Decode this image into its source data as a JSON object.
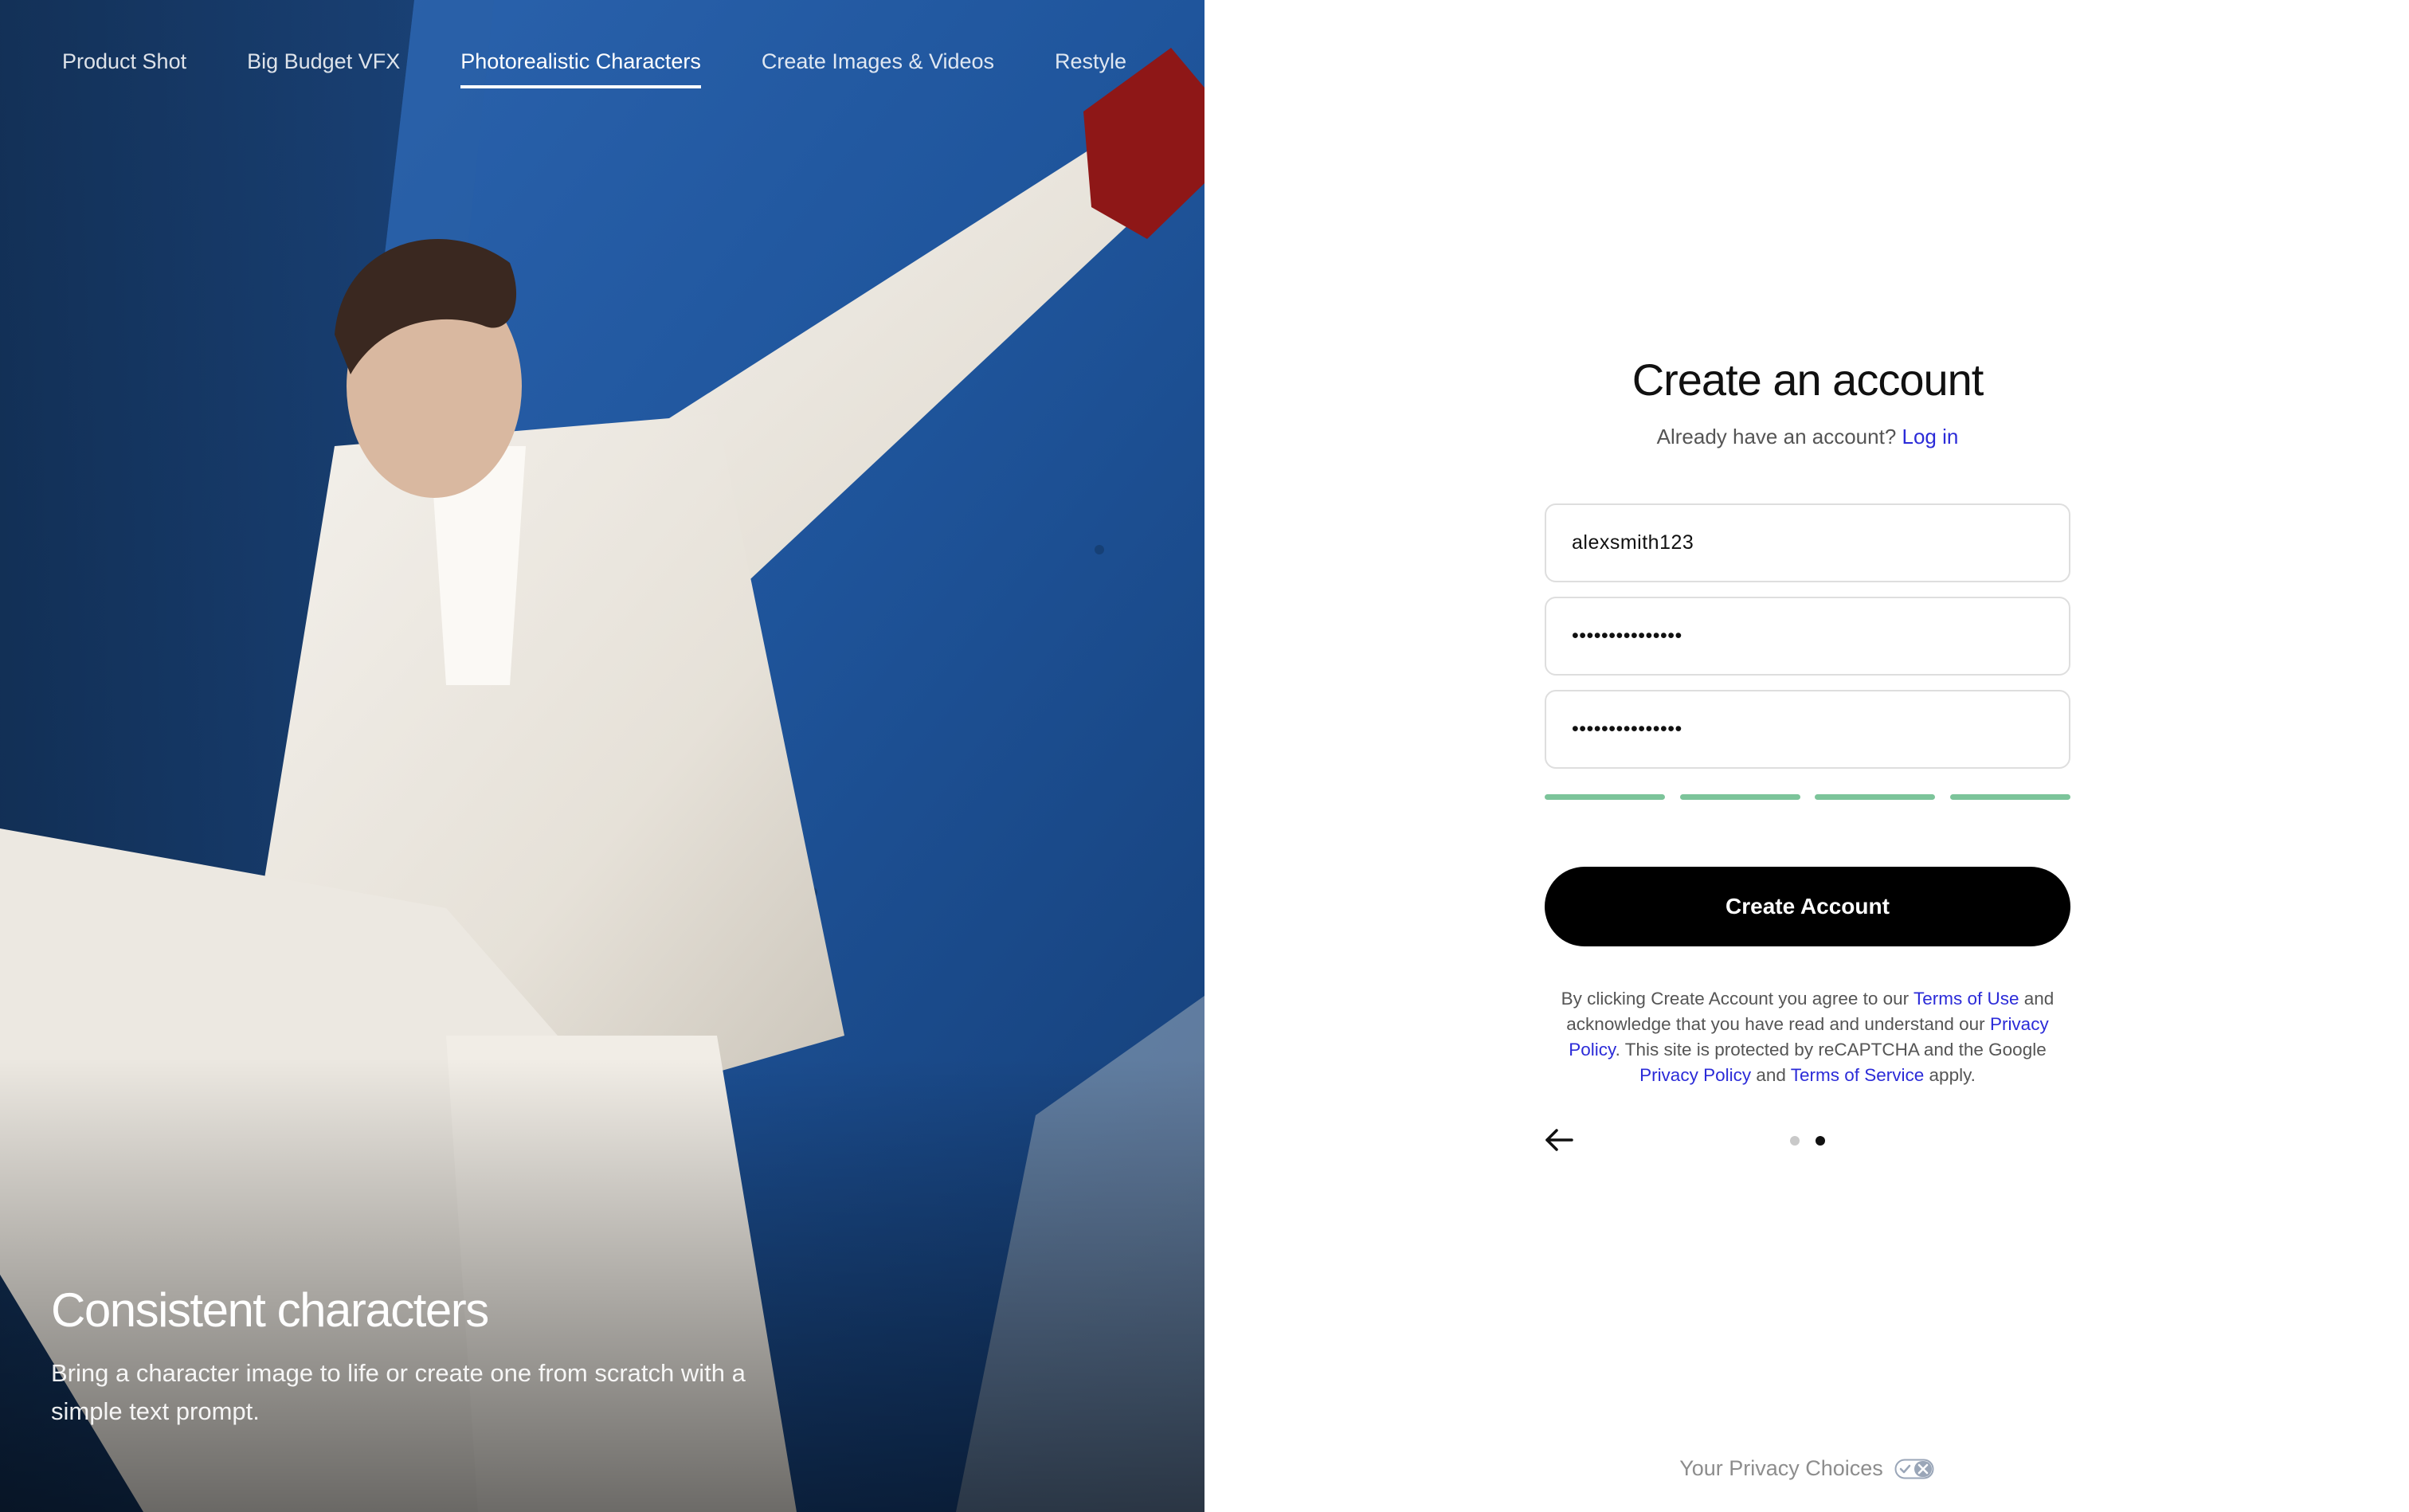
{
  "hero": {
    "tabs": [
      {
        "label": "Product Shot",
        "active": false
      },
      {
        "label": "Big Budget VFX",
        "active": false
      },
      {
        "label": "Photorealistic Characters",
        "active": true
      },
      {
        "label": "Create Images & Videos",
        "active": false
      },
      {
        "label": "Restyle",
        "active": false
      }
    ],
    "title": "Consistent characters",
    "description": "Bring a character image to life or create one from scratch with a simple text prompt."
  },
  "form": {
    "title": "Create an account",
    "login_prompt": "Already have an account?",
    "login_link": "Log in",
    "username_value": "alexsmith123",
    "password_value": "•••••••••••••••",
    "confirm_password_value": "•••••••••••••••",
    "strength_segments": 4,
    "strength_color": "#7cc49a",
    "submit_label": "Create Account",
    "legal": {
      "prefix": "By clicking Create Account you agree to our ",
      "terms_of_use": "Terms of Use",
      "middle1": " and acknowledge that you have read and understand our ",
      "privacy_policy": "Privacy Policy",
      "middle2": ". This site is protected by reCAPTCHA and the Google ",
      "google_privacy": "Privacy Policy",
      "middle3": " and ",
      "google_terms": "Terms of Service",
      "suffix": " apply."
    },
    "pager": {
      "total": 2,
      "current": 2
    }
  },
  "footer": {
    "privacy_choices": "Your Privacy Choices",
    "privacy_icon": "privacy-toggle-icon"
  },
  "colors": {
    "link": "#2b2bd8",
    "button_bg": "#000000",
    "hero_blue": "#1d4f93"
  }
}
